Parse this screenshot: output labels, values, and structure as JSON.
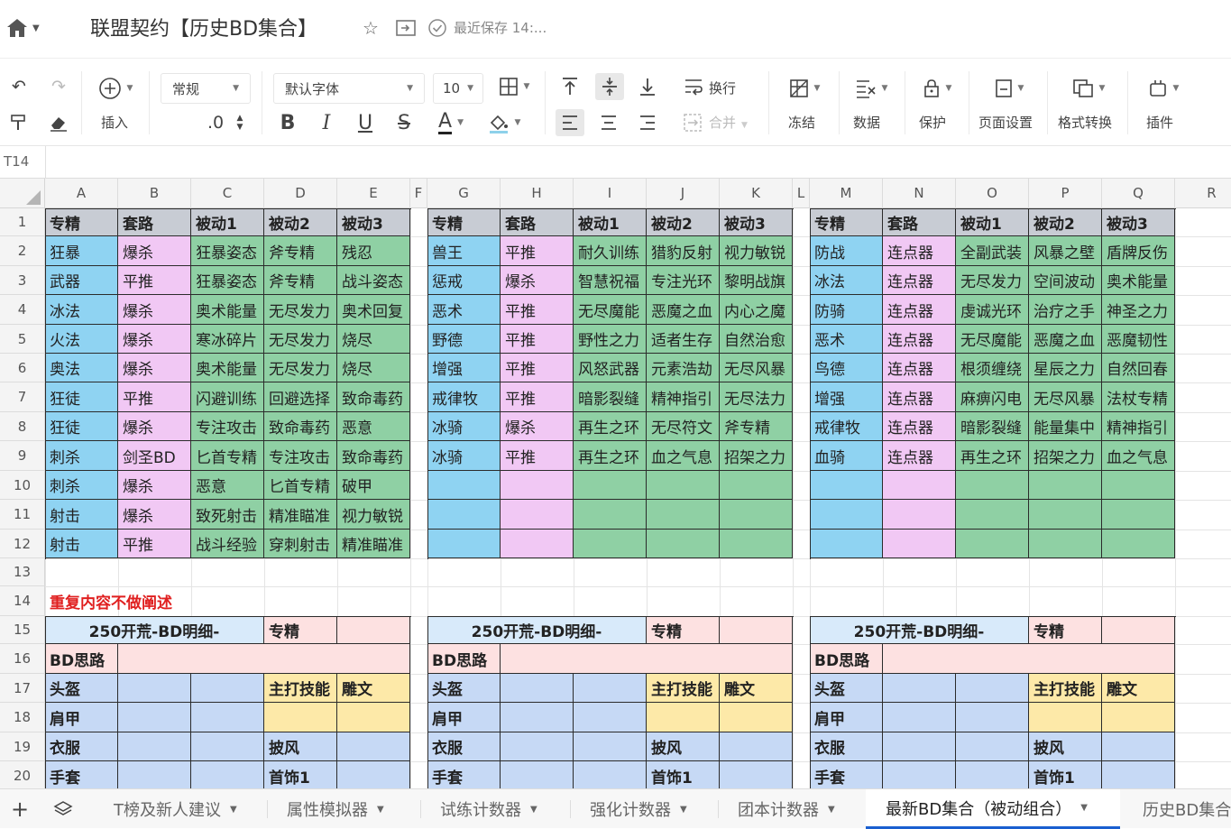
{
  "window": {
    "title": "联盟契约【历史BD集合】",
    "save_status": "最近保存 14:..."
  },
  "toolbar": {
    "insert_label": "插入",
    "format_value": "常规",
    "decimal_label": ".0",
    "font_name": "默认字体",
    "font_size": "10",
    "wrap_label": "换行",
    "merge_label": "合并",
    "freeze_label": "冻结",
    "data_label": "数据",
    "protect_label": "保护",
    "page_setup_label": "页面设置",
    "format_convert_label": "格式转换",
    "plugin_label": "插件",
    "bold": "B",
    "italic": "I",
    "underline": "U",
    "strike": "S",
    "font_color_letter": "A"
  },
  "formula_bar": {
    "cell_ref": "T14"
  },
  "columns": [
    "A",
    "B",
    "C",
    "D",
    "E",
    "F",
    "G",
    "H",
    "I",
    "J",
    "K",
    "L",
    "M",
    "N",
    "O",
    "P",
    "Q",
    "R"
  ],
  "rows": [
    "1",
    "2",
    "3",
    "4",
    "5",
    "6",
    "7",
    "8",
    "9",
    "10",
    "11",
    "12",
    "13",
    "14",
    "15",
    "16",
    "17",
    "18",
    "19",
    "20"
  ],
  "colors": {
    "header_gray": "#c8ccd4",
    "spec_blue": "#8fd3f2",
    "route_pink": "#f1c8f4",
    "passive_green": "#8fd0a4",
    "detail_blue": "#c6d9f5",
    "detail_pink": "#fde1e1",
    "detail_yellow": "#fde9a8",
    "title_blue": "#d8eafa"
  },
  "table_headers": [
    "专精",
    "套路",
    "被动1",
    "被动2",
    "被动3"
  ],
  "block1": [
    [
      "狂暴",
      "爆杀",
      "狂暴姿态",
      "斧专精",
      "残忍"
    ],
    [
      "武器",
      "平推",
      "狂暴姿态",
      "斧专精",
      "战斗姿态"
    ],
    [
      "冰法",
      "爆杀",
      "奥术能量",
      "无尽发力",
      "奥术回复"
    ],
    [
      "火法",
      "爆杀",
      "寒冰碎片",
      "无尽发力",
      "烧尽"
    ],
    [
      "奥法",
      "爆杀",
      "奥术能量",
      "无尽发力",
      "烧尽"
    ],
    [
      "狂徒",
      "平推",
      "闪避训练",
      "回避选择",
      "致命毒药"
    ],
    [
      "狂徒",
      "爆杀",
      "专注攻击",
      "致命毒药",
      "恶意"
    ],
    [
      "刺杀",
      "剑圣BD",
      "匕首专精",
      "专注攻击",
      "致命毒药"
    ],
    [
      "刺杀",
      "爆杀",
      "恶意",
      "匕首专精",
      "破甲"
    ],
    [
      "射击",
      "爆杀",
      "致死射击",
      "精准瞄准",
      "视力敏锐"
    ],
    [
      "射击",
      "平推",
      "战斗经验",
      "穿刺射击",
      "精准瞄准"
    ]
  ],
  "block2": [
    [
      "兽王",
      "平推",
      "耐久训练",
      "猎豹反射",
      "视力敏锐"
    ],
    [
      "惩戒",
      "爆杀",
      "智慧祝福",
      "专注光环",
      "黎明战旗"
    ],
    [
      "恶术",
      "平推",
      "无尽魔能",
      "恶魔之血",
      "内心之魔"
    ],
    [
      "野德",
      "平推",
      "野性之力",
      "适者生存",
      "自然治愈"
    ],
    [
      "增强",
      "平推",
      "风怒武器",
      "元素浩劫",
      "无尽风暴"
    ],
    [
      "戒律牧",
      "平推",
      "暗影裂缝",
      "精神指引",
      "无尽法力"
    ],
    [
      "冰骑",
      "爆杀",
      "再生之环",
      "无尽符文",
      "斧专精"
    ],
    [
      "冰骑",
      "平推",
      "再生之环",
      "血之气息",
      "招架之力"
    ],
    [
      "",
      "",
      "",
      "",
      ""
    ],
    [
      "",
      "",
      "",
      "",
      ""
    ],
    [
      "",
      "",
      "",
      "",
      ""
    ]
  ],
  "block3": [
    [
      "防战",
      "连点器",
      "全副武装",
      "风暴之壁",
      "盾牌反伤"
    ],
    [
      "冰法",
      "连点器",
      "无尽发力",
      "空间波动",
      "奥术能量"
    ],
    [
      "防骑",
      "连点器",
      "虔诚光环",
      "治疗之手",
      "神圣之力"
    ],
    [
      "恶术",
      "连点器",
      "无尽魔能",
      "恶魔之血",
      "恶魔韧性"
    ],
    [
      "鸟德",
      "连点器",
      "根须缠绕",
      "星辰之力",
      "自然回春"
    ],
    [
      "增强",
      "连点器",
      "麻痹闪电",
      "无尽风暴",
      "法杖专精"
    ],
    [
      "戒律牧",
      "连点器",
      "暗影裂缝",
      "能量集中",
      "精神指引"
    ],
    [
      "血骑",
      "连点器",
      "再生之环",
      "招架之力",
      "血之气息"
    ],
    [
      "",
      "",
      "",
      "",
      ""
    ],
    [
      "",
      "",
      "",
      "",
      ""
    ],
    [
      "",
      "",
      "",
      "",
      ""
    ]
  ],
  "note_row14": "重复内容不做阐述",
  "detail": {
    "title": "250开荒-BD明细-",
    "spec_label": "专精",
    "bd_idea_label": "BD思路",
    "helmet_label": "头盔",
    "main_skill_label": "主打技能",
    "rune_label": "雕文",
    "shoulder_label": "肩甲",
    "chest_label": "衣服",
    "cloak_label": "披风",
    "gloves_label": "手套",
    "trinket_label": "首饰1"
  },
  "sheet_tabs": [
    "T榜及新人建议",
    "属性模拟器",
    "试练计数器",
    "强化计数器",
    "团本计数器",
    "最新BD集合（被动组合）",
    "历史BD集合"
  ],
  "active_sheet_index": 5
}
